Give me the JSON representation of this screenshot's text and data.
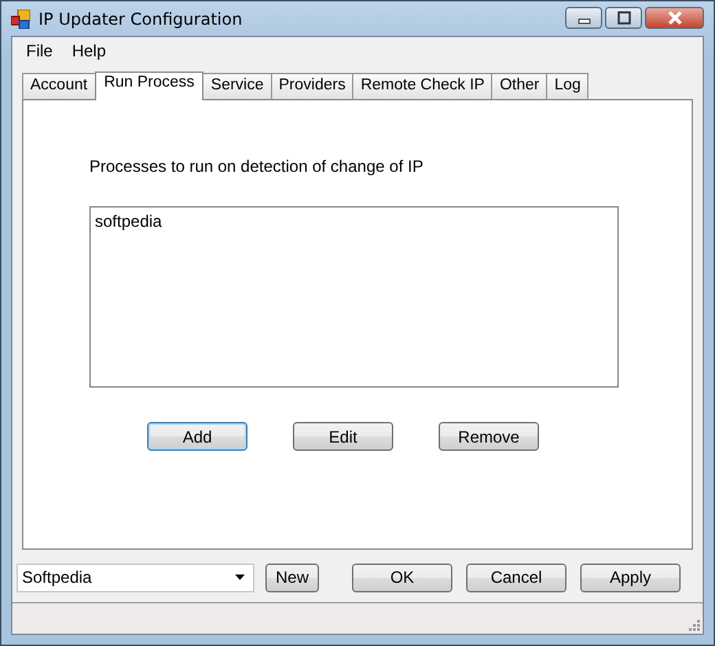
{
  "window": {
    "title": "IP Updater Configuration"
  },
  "menu": [
    "File",
    "Help"
  ],
  "tabs": [
    {
      "label": "Account",
      "selected": false
    },
    {
      "label": "Run Process",
      "selected": true
    },
    {
      "label": "Service",
      "selected": false
    },
    {
      "label": "Providers",
      "selected": false
    },
    {
      "label": "Remote Check IP",
      "selected": false
    },
    {
      "label": "Other",
      "selected": false
    },
    {
      "label": "Log",
      "selected": false
    }
  ],
  "panel": {
    "caption": "Processes to run on detection of change of IP",
    "items": [
      {
        "label": "softpedia",
        "selected": false
      }
    ],
    "buttons": [
      {
        "label": "Add",
        "focused": true
      },
      {
        "label": "Edit",
        "focused": false
      },
      {
        "label": "Remove",
        "focused": false
      }
    ]
  },
  "profile": {
    "value": "Softpedia"
  },
  "new_button": "New",
  "buttons": [
    "OK",
    "Cancel",
    "Apply"
  ]
}
